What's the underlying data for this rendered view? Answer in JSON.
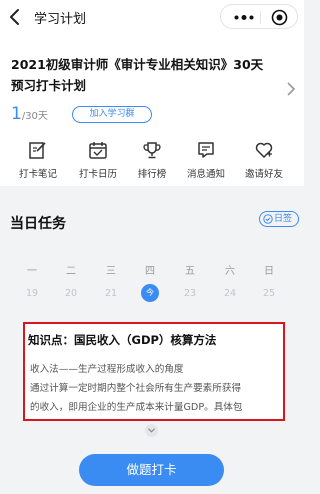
{
  "nav": {
    "title": "学习计划"
  },
  "plan": {
    "title": "2021初级审计师《审计专业相关知识》30天预习打卡计划",
    "progress_current": "1",
    "progress_total": "/30天",
    "join_group_label": "加入学习群"
  },
  "tools": [
    {
      "label": "打卡笔记",
      "icon": "note-edit-icon"
    },
    {
      "label": "打卡日历",
      "icon": "calendar-icon"
    },
    {
      "label": "排行榜",
      "icon": "trophy-icon"
    },
    {
      "label": "消息通知",
      "icon": "message-icon"
    },
    {
      "label": "邀请好友",
      "icon": "invite-heart-icon"
    }
  ],
  "tasks": {
    "title": "当日任务",
    "sign_label": "日签",
    "weekdays": [
      "一",
      "二",
      "三",
      "四",
      "五",
      "六",
      "日"
    ],
    "dates": [
      "19",
      "20",
      "21",
      "今",
      "23",
      "24",
      "25"
    ],
    "today_label": "今"
  },
  "knowledge": {
    "title": "知识点：国民收入（GDP）核算方法",
    "lines": [
      "收入法——生产过程形成收入的角度",
      "通过计算一定时期内整个社会所有生产要素所获得",
      "的收入，即用企业的生产成本来计量GDP。具体包"
    ]
  },
  "cta": {
    "label": "做题打卡"
  },
  "colors": {
    "accent": "#3b8cf2",
    "highlight_border": "#d8161d"
  }
}
